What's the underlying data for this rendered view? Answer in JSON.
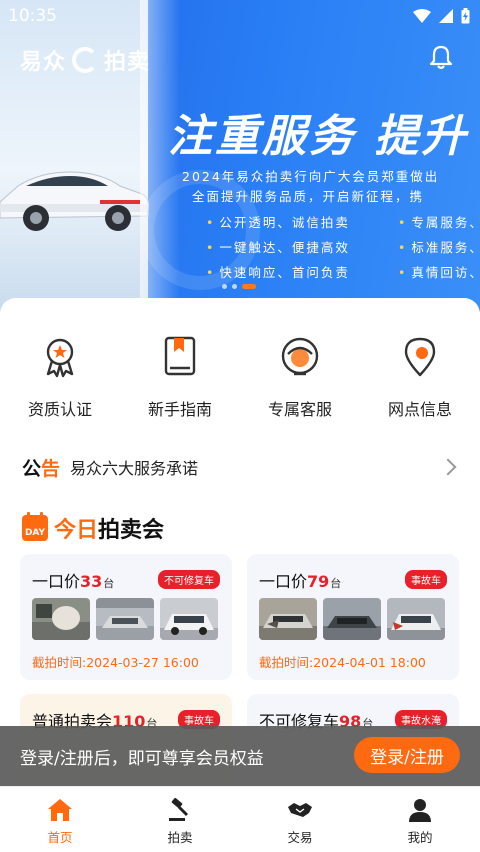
{
  "status_bar": {
    "time": "10:35"
  },
  "banner": {
    "logo_left": "易众",
    "logo_right": "拍卖",
    "headline": "注重服务  提升",
    "subline_1": "2024年易众拍卖行向广大会员郑重做出",
    "subline_2": "全面提升服务品质，开启新征程，携",
    "bullets": [
      "公开透明、诚信拍卖",
      "专属服务、",
      "一键触达、便捷高效",
      "标准服务、",
      "快速响应、首问负责",
      "真情回访、"
    ],
    "active_slide": 3
  },
  "quick_links": [
    {
      "label": "资质认证",
      "icon": "certificate-icon"
    },
    {
      "label": "新手指南",
      "icon": "guide-book-icon"
    },
    {
      "label": "专属客服",
      "icon": "customer-service-icon"
    },
    {
      "label": "网点信息",
      "icon": "location-pin-icon"
    }
  ],
  "notice": {
    "tag_a": "公",
    "tag_b": "告",
    "text": "易众六大服务承诺"
  },
  "today": {
    "prefix": "今日",
    "suffix": "拍卖会",
    "icon_text": "DAY"
  },
  "auctions": [
    {
      "title": "一口价",
      "count": "33",
      "unit": "台",
      "tag": "不可修复车",
      "time": "截拍时间:2024-03-27 16:00"
    },
    {
      "title": "一口价",
      "count": "79",
      "unit": "台",
      "tag": "事故车",
      "time": "截拍时间:2024-04-01 18:00"
    },
    {
      "title": "普通拍卖会",
      "count": "110",
      "unit": "台",
      "tag": "事故车",
      "time": ""
    },
    {
      "title": "不可修复车",
      "count": "98",
      "unit": "台",
      "tag": "事故水淹",
      "time": ""
    }
  ],
  "login_bar": {
    "text": "登录/注册后，即可尊享会员权益",
    "button": "登录/注册"
  },
  "tabs": [
    {
      "label": "首页",
      "icon": "home-icon",
      "active": true
    },
    {
      "label": "拍卖",
      "icon": "gavel-icon",
      "active": false
    },
    {
      "label": "交易",
      "icon": "handshake-icon",
      "active": false
    },
    {
      "label": "我的",
      "icon": "user-icon",
      "active": false
    }
  ],
  "colors": {
    "accent": "#ff6a10",
    "tag_red": "#e8202a",
    "banner_blue": "#2a7ff5"
  }
}
